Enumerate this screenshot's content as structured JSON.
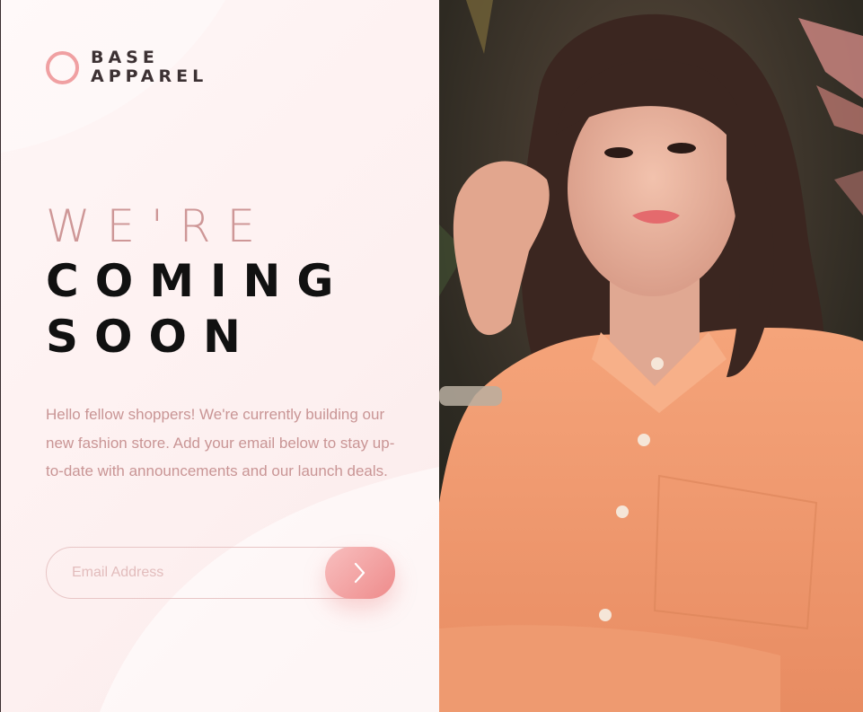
{
  "brand": {
    "line1": "BASE",
    "line2": "APPAREL"
  },
  "headline": {
    "light": "WE'RE",
    "dark_line1": "COMING",
    "dark_line2": "SOON"
  },
  "intro": "Hello fellow shoppers! We're currently building our new fashion store. Add your email below to stay up-to-date with announcements and our launch deals.",
  "form": {
    "email_placeholder": "Email Address",
    "email_value": ""
  },
  "icons": {
    "logo": "ring-logo-icon",
    "submit": "chevron-right-icon"
  },
  "colors": {
    "accent_pink": "#ee8b8b",
    "light_pink": "#f8bfbf",
    "text_rose": "#ce9797",
    "dark_text": "#111111",
    "shirt_orange": "#f29a6e"
  }
}
